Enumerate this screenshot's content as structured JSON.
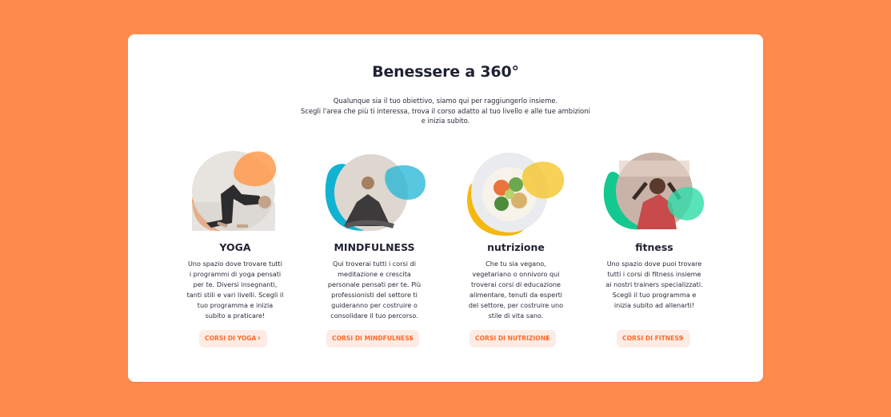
{
  "section": {
    "title": "Benessere a 360°",
    "intro": [
      "Qualunque sia il tuo obiettivo, siamo qui per raggiungerlo insieme.",
      "Scegli l'area che più ti interessa, trova il corso adatto al tuo livello e alle tue ambizioni",
      "e inizia subito."
    ]
  },
  "categories": [
    {
      "title": "YOGA",
      "desc": [
        "Uno spazio dove trovare tutti",
        "i programmi di yoga pensati",
        "per te. Diversi insegnanti,",
        "tanti stili e vari livelli. Scegli il",
        "tuo programma e inizia",
        "subito a praticare!"
      ],
      "button": "CORSI DI YOGA",
      "accent": "#ff8a3d",
      "image": "yoga-pose-photo"
    },
    {
      "title": "MINDFULNESS",
      "desc": [
        "Qui troverai tutti i corsi di",
        "meditazione e crescita",
        "personale pensati per te. Più",
        "professionisti del settore ti",
        "guideranno per costruire o",
        "consolidare il tuo percorso."
      ],
      "button": "CORSI DI MINDFULNESS",
      "accent": "#1fb6d6",
      "image": "meditation-photo"
    },
    {
      "title": "nutrizione",
      "desc": [
        "Che tu sia vegano,",
        "vegetariano o onnivoro qui",
        "troverai corsi di educazione",
        "alimentare, tenuti da esperti",
        "del settore, per costruire uno",
        "stile di vita sano."
      ],
      "button": "CORSI DI NUTRIZIONE",
      "accent": "#f5b80f",
      "image": "food-bowl-photo"
    },
    {
      "title": "fitness",
      "desc": [
        "Uno spazio dove puoi trovare",
        "tutti i corsi di fitness insieme",
        "ai nostri trainers specializzati.",
        "Scegli il tuo programma e",
        "inizia subito ad allenarti!"
      ],
      "button": "CORSI DI FITNESS",
      "accent": "#22d3a0",
      "image": "fitness-photo"
    }
  ],
  "chevron_icon": "chevron-right-icon"
}
